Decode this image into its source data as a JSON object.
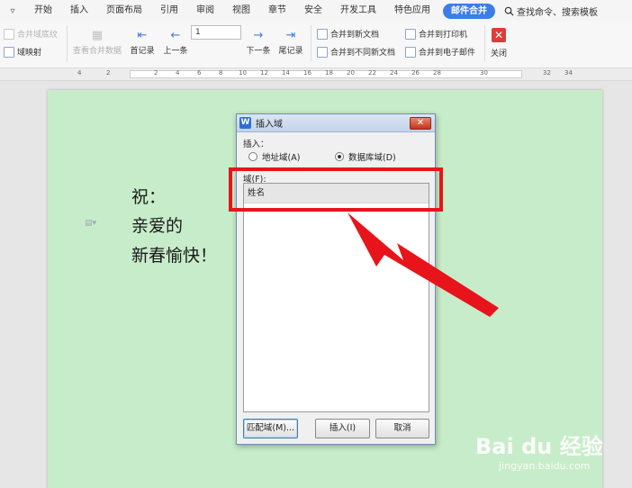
{
  "menubar": {
    "caret": "▿",
    "tabs": [
      "开始",
      "插入",
      "页面布局",
      "引用",
      "审阅",
      "视图",
      "章节",
      "安全",
      "开发工具",
      "特色应用",
      "邮件合并"
    ],
    "active_tab": "邮件合并",
    "search": "查找命令、搜索模板"
  },
  "ribbon": {
    "merge_field_highlight": "合并域底纹",
    "field_mapping": "域映射",
    "view_merged_data": "查看合并数据",
    "first_record": "首记录",
    "previous": "上一条",
    "record_number": "1",
    "next": "下一条",
    "last_record": "尾记录",
    "merge_to_new_doc": "合并到新文档",
    "merge_to_separate_docs": "合并到不同新文档",
    "merge_to_printer": "合并到打印机",
    "merge_to_email": "合并到电子邮件",
    "close": "关闭"
  },
  "ruler": {
    "ticks": [
      "4",
      "2",
      "2",
      "4",
      "6",
      "8",
      "10",
      "12",
      "14",
      "16",
      "18",
      "20",
      "22",
      "24",
      "26",
      "28",
      "30",
      "32",
      "34"
    ]
  },
  "document": {
    "lines": [
      "祝：",
      "亲爱的",
      "新春愉快！"
    ]
  },
  "dialog": {
    "title": "插入域",
    "insert_label": "插入：",
    "radio_address": "地址域(A)",
    "radio_database": "数据库域(D)",
    "selected_radio": "数据库域(D)",
    "fields_label": "域(F):",
    "fields": [
      "姓名"
    ],
    "buttons": {
      "match_fields": "匹配域(M)...",
      "insert": "插入(I)",
      "cancel": "取消"
    }
  },
  "colors": {
    "accent": "#3c7de8",
    "page_bg": "#c7ecc9",
    "highlight": "#e8141b"
  },
  "watermark": {
    "brand": "Bai du 经验",
    "url": "jingyan.baidu.com"
  }
}
